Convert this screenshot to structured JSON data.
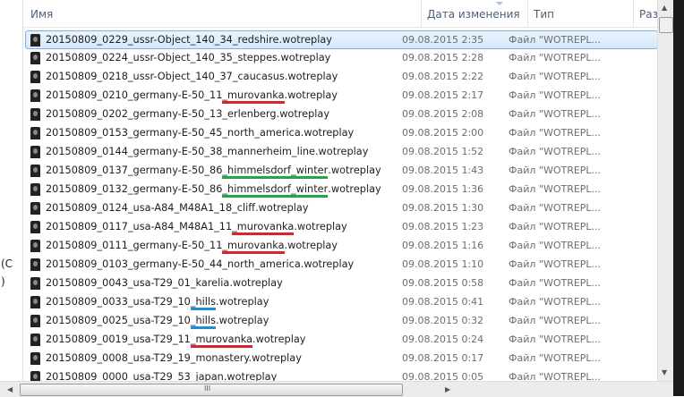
{
  "left_pane": {
    "fragments": [
      "(C",
      ")"
    ]
  },
  "columns": {
    "name": "Имя",
    "date": "Дата изменения",
    "type": "Тип",
    "size": "Раз"
  },
  "underline_colors": {
    "red": "#d9232a",
    "green": "#22a64a",
    "blue": "#1c8fd6"
  },
  "files": [
    {
      "pre": "20150809_0229_ussr-Object_140_34_redshire.wotreplay",
      "u": "",
      "post": "",
      "date": "09.08.2015 2:35",
      "type": "Файл \"WOTREPL...",
      "selected": true
    },
    {
      "pre": "20150809_0224_ussr-Object_140_35_steppes.wotreplay",
      "u": "",
      "post": "",
      "date": "09.08.2015 2:28",
      "type": "Файл \"WOTREPL..."
    },
    {
      "pre": "20150809_0218_ussr-Object_140_37_caucasus.wotreplay",
      "u": "",
      "post": "",
      "date": "09.08.2015 2:22",
      "type": "Файл \"WOTREPL..."
    },
    {
      "pre": "20150809_0210_germany-E-50_11",
      "u": "_murovanka",
      "post": ".wotreplay",
      "color": "red",
      "date": "09.08.2015 2:17",
      "type": "Файл \"WOTREPL..."
    },
    {
      "pre": "20150809_0202_germany-E-50_13_erlenberg.wotreplay",
      "u": "",
      "post": "",
      "date": "09.08.2015 2:08",
      "type": "Файл \"WOTREPL..."
    },
    {
      "pre": "20150809_0153_germany-E-50_45_north_america.wotreplay",
      "u": "",
      "post": "",
      "date": "09.08.2015 2:00",
      "type": "Файл \"WOTREPL..."
    },
    {
      "pre": "20150809_0144_germany-E-50_38_mannerheim_line.wotreplay",
      "u": "",
      "post": "",
      "date": "09.08.2015 1:52",
      "type": "Файл \"WOTREPL..."
    },
    {
      "pre": "20150809_0137_germany-E-50_86",
      "u": "_himmelsdorf_winter",
      "post": ".wotreplay",
      "color": "green",
      "date": "09.08.2015 1:43",
      "type": "Файл \"WOTREPL..."
    },
    {
      "pre": "20150809_0132_germany-E-50_86",
      "u": "_himmelsdorf_winter",
      "post": ".wotreplay",
      "color": "green",
      "date": "09.08.2015 1:36",
      "type": "Файл \"WOTREPL..."
    },
    {
      "pre": "20150809_0124_usa-A84_M48A1_18_cliff.wotreplay",
      "u": "",
      "post": "",
      "date": "09.08.2015 1:30",
      "type": "Файл \"WOTREPL..."
    },
    {
      "pre": "20150809_0117_usa-A84_M48A1_11",
      "u": "_murovanka",
      "post": ".wotreplay",
      "color": "red",
      "date": "09.08.2015 1:23",
      "type": "Файл \"WOTREPL..."
    },
    {
      "pre": "20150809_0111_germany-E-50_11",
      "u": "_murovanka",
      "post": ".wotreplay",
      "color": "red",
      "date": "09.08.2015 1:16",
      "type": "Файл \"WOTREPL..."
    },
    {
      "pre": "20150809_0103_germany-E-50_44_north_america.wotreplay",
      "u": "",
      "post": "",
      "date": "09.08.2015 1:10",
      "type": "Файл \"WOTREPL..."
    },
    {
      "pre": "20150809_0043_usa-T29_01_karelia.wotreplay",
      "u": "",
      "post": "",
      "date": "09.08.2015 0:58",
      "type": "Файл \"WOTREPL..."
    },
    {
      "pre": "20150809_0033_usa-T29_10",
      "u": "_hills",
      "post": ".wotreplay",
      "color": "blue",
      "date": "09.08.2015 0:41",
      "type": "Файл \"WOTREPL..."
    },
    {
      "pre": "20150809_0025_usa-T29_10",
      "u": "_hills",
      "post": ".wotreplay",
      "color": "blue",
      "date": "09.08.2015 0:32",
      "type": "Файл \"WOTREPL..."
    },
    {
      "pre": "20150809_0019_usa-T29_11",
      "u": "_murovanka",
      "post": ".wotreplay",
      "color": "red",
      "date": "09.08.2015 0:24",
      "type": "Файл \"WOTREPL..."
    },
    {
      "pre": "20150809_0008_usa-T29_19_monastery.wotreplay",
      "u": "",
      "post": "",
      "date": "09.08.2015 0:17",
      "type": "Файл \"WOTREPL..."
    },
    {
      "pre": "20150809_0000_usa-T29_53_japan.wotreplay",
      "u": "",
      "post": "",
      "date": "09.08.2015 0:05",
      "type": "Файл \"WOTREPL..."
    }
  ]
}
